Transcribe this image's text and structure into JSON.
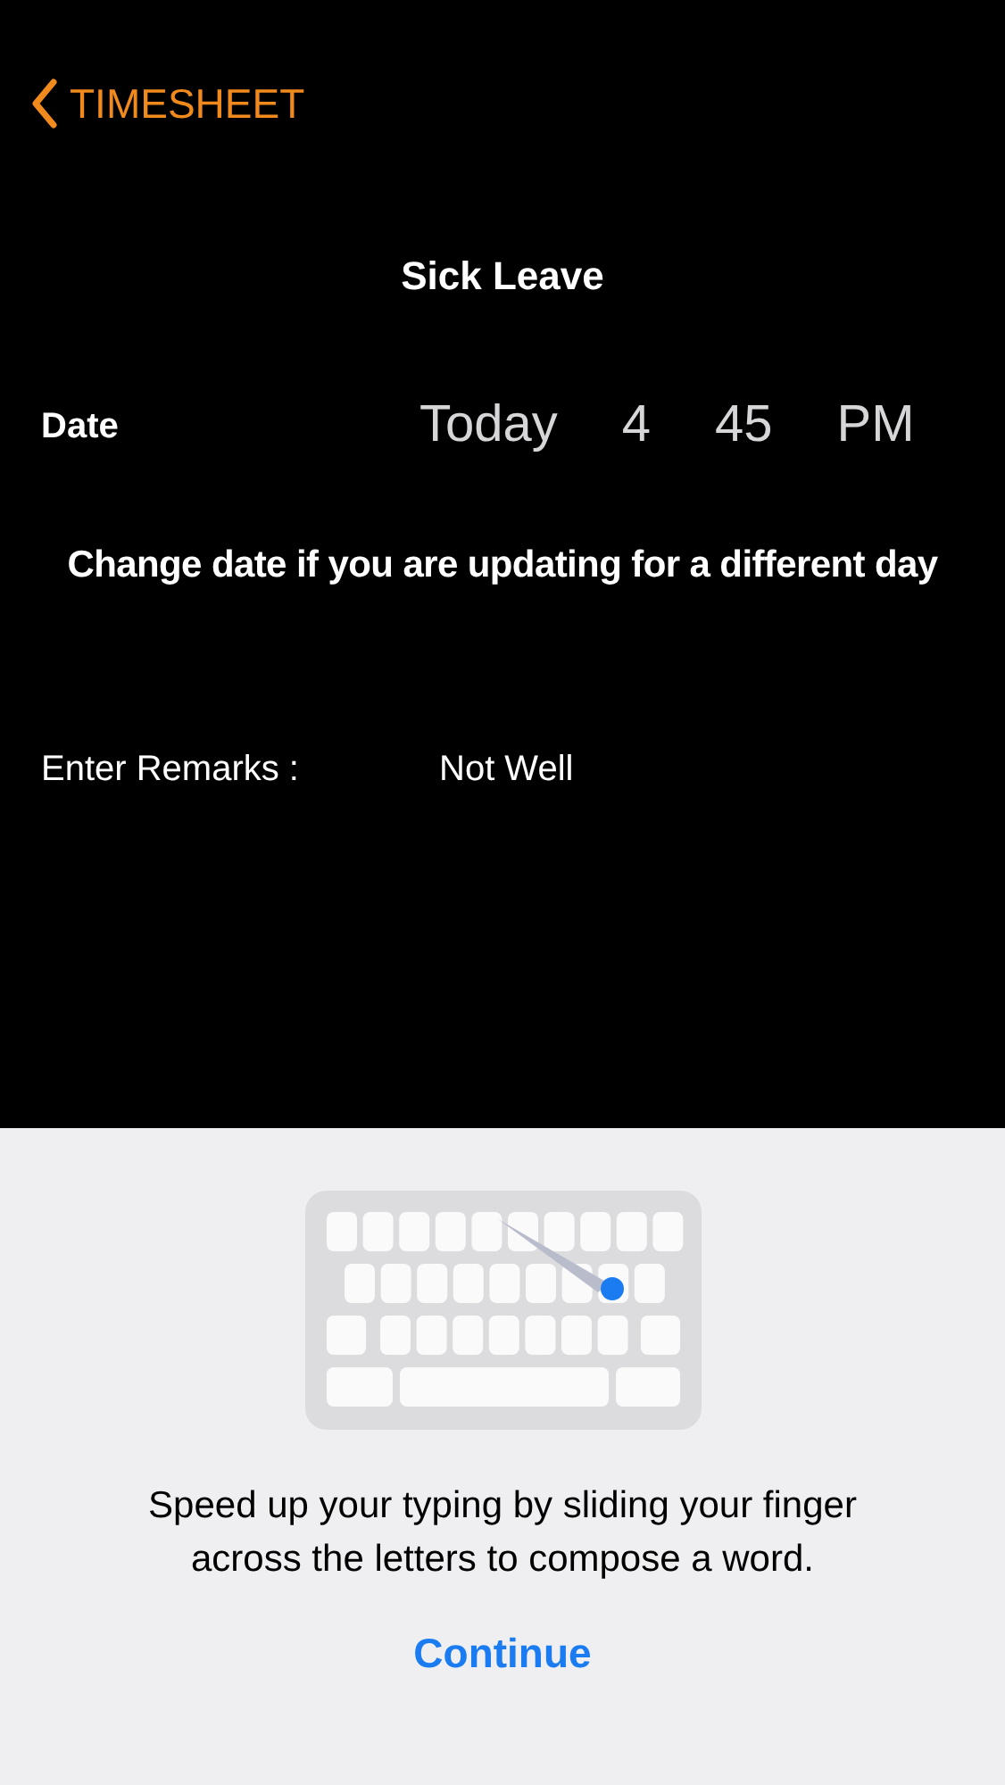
{
  "nav": {
    "back_label": "TIMESHEET"
  },
  "title": "Sick Leave",
  "date_row": {
    "label": "Date",
    "picker": [
      "Today",
      "4",
      "45",
      "PM"
    ]
  },
  "hint": "Change date if you are updating for a different day",
  "remarks": {
    "label": "Enter Remarks :",
    "value": "Not Well"
  },
  "tip_sheet": {
    "message": "Speed up your typing by sliding your finger across the letters to compose a word.",
    "button": "Continue"
  }
}
